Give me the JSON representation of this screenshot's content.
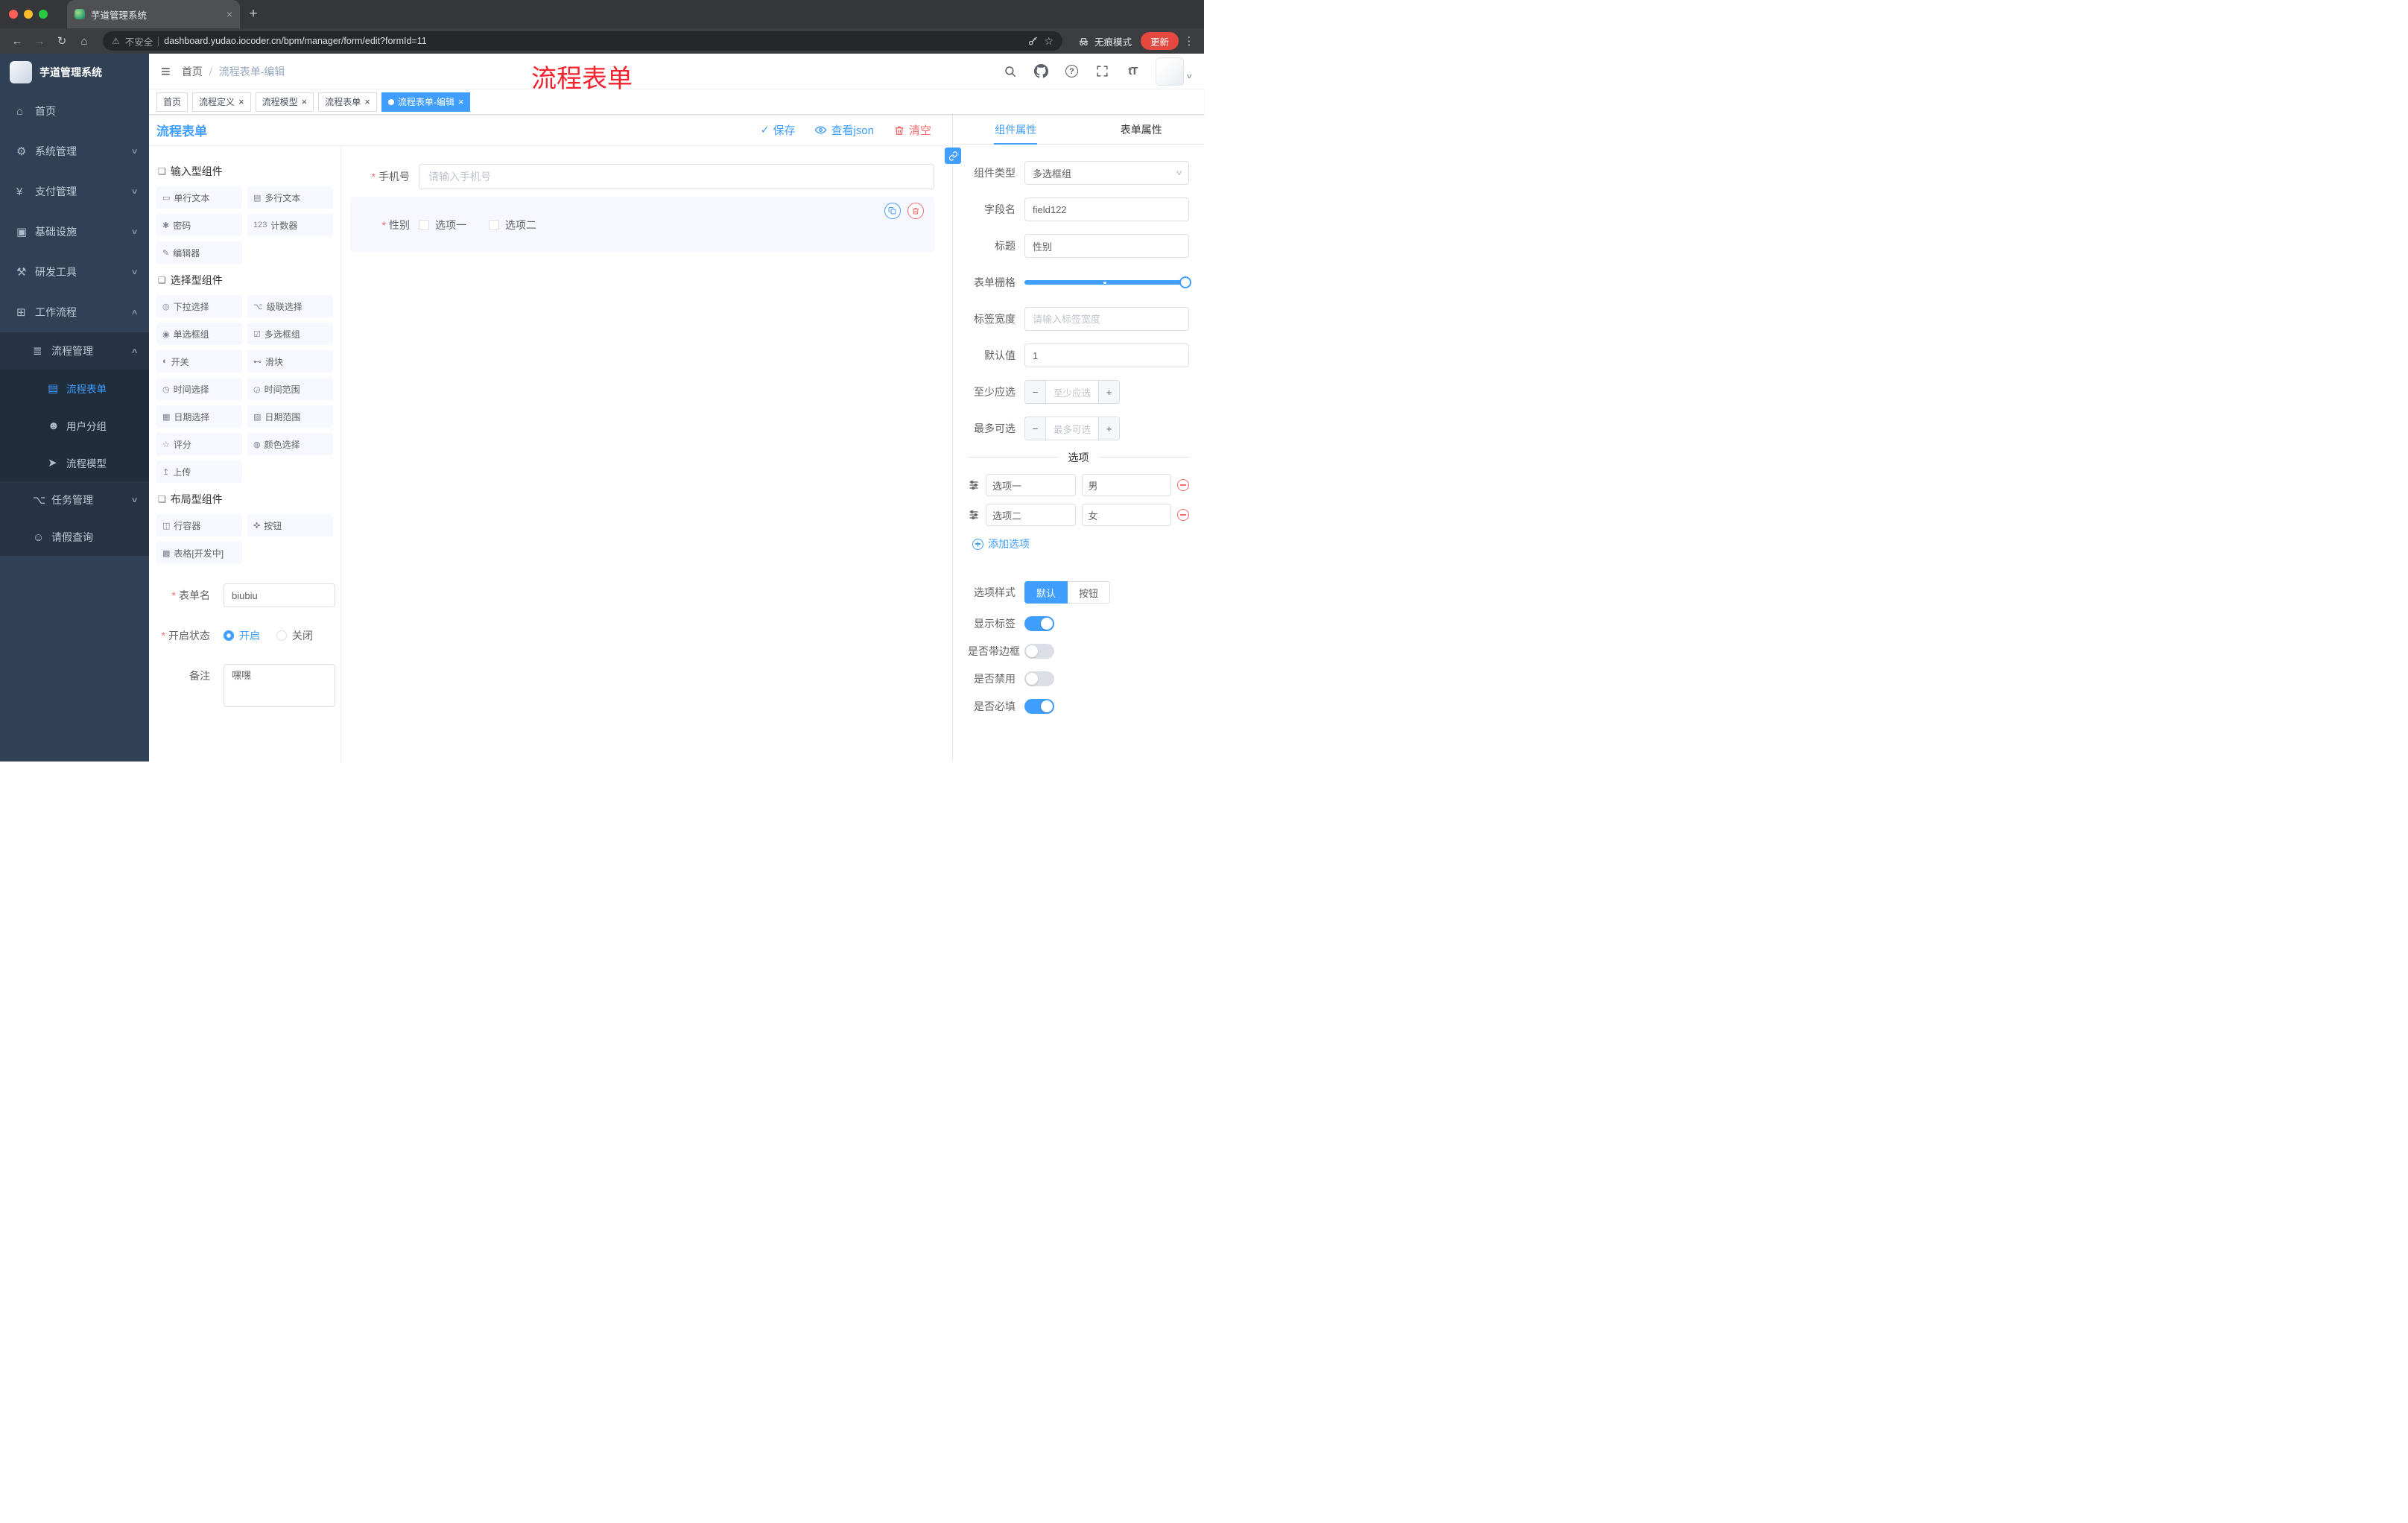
{
  "theme": {
    "primary": "#409eff",
    "danger": "#f56c6c",
    "annotation_red": "#f5222d",
    "sidebar_bg": "#304156",
    "active_tag_bg": "#409eff"
  },
  "browser": {
    "tab_title": "芋道管理系统",
    "security_label": "不安全",
    "url": "dashboard.yudao.iocoder.cn/bpm/manager/form/edit?formId=11",
    "incognito_label": "无痕模式",
    "update_label": "更新"
  },
  "sidebar": {
    "logo_title": "芋道管理系统",
    "menu": [
      {
        "label": "首页",
        "icon": "home-icon"
      },
      {
        "label": "系统管理",
        "icon": "gear-icon",
        "arrow": "collapsed"
      },
      {
        "label": "支付管理",
        "icon": "payment-icon",
        "arrow": "collapsed"
      },
      {
        "label": "基础设施",
        "icon": "infrastructure-icon",
        "arrow": "collapsed"
      },
      {
        "label": "研发工具",
        "icon": "devtools-icon",
        "arrow": "collapsed"
      },
      {
        "label": "工作流程",
        "icon": "workflow-icon",
        "arrow": "expanded"
      }
    ],
    "process_menu": {
      "label": "流程管理",
      "icon": "process-icon",
      "arrow": "expanded"
    },
    "process_children": [
      {
        "label": "流程表单",
        "icon": "form-icon",
        "active": true
      },
      {
        "label": "用户分组",
        "icon": "users-icon"
      },
      {
        "label": "流程模型",
        "icon": "model-icon"
      }
    ],
    "workflow_siblings": [
      {
        "label": "任务管理",
        "icon": "task-icon",
        "arrow": "collapsed"
      },
      {
        "label": "请假查询",
        "icon": "person-icon"
      }
    ]
  },
  "header": {
    "breadcrumb_home": "首页",
    "breadcrumb_separator": "/",
    "breadcrumb_current": "流程表单-编辑",
    "annotation": "流程表单"
  },
  "tags": [
    {
      "label": "首页"
    },
    {
      "label": "流程定义",
      "closable": true
    },
    {
      "label": "流程模型",
      "closable": true
    },
    {
      "label": "流程表单",
      "closable": true
    },
    {
      "label": "流程表单-编辑",
      "closable": true,
      "active": true
    }
  ],
  "designer": {
    "title": "流程表单",
    "save_label": "保存",
    "view_json_label": "查看json",
    "clear_label": "清空",
    "groups": [
      {
        "title": "输入型组件",
        "items": [
          {
            "label": "单行文本",
            "icon": "input-icon"
          },
          {
            "label": "多行文本",
            "icon": "textarea-icon"
          },
          {
            "label": "密码",
            "icon": "password-icon"
          },
          {
            "label": "计数器",
            "icon": "counter-icon"
          },
          {
            "label": "编辑器",
            "icon": "editor-icon"
          }
        ]
      },
      {
        "title": "选择型组件",
        "items": [
          {
            "label": "下拉选择",
            "icon": "select-icon"
          },
          {
            "label": "级联选择",
            "icon": "cascader-icon"
          },
          {
            "label": "单选框组",
            "icon": "radio-icon"
          },
          {
            "label": "多选框组",
            "icon": "checkbox-group-icon"
          },
          {
            "label": "开关",
            "icon": "switch-icon"
          },
          {
            "label": "滑块",
            "icon": "slider-icon"
          },
          {
            "label": "时间选择",
            "icon": "time-icon"
          },
          {
            "label": "时间范围",
            "icon": "time-range-icon"
          },
          {
            "label": "日期选择",
            "icon": "date-icon"
          },
          {
            "label": "日期范围",
            "icon": "date-range-icon"
          },
          {
            "label": "评分",
            "icon": "rate-icon"
          },
          {
            "label": "颜色选择",
            "icon": "color-icon"
          },
          {
            "label": "上传",
            "icon": "upload-icon"
          }
        ]
      },
      {
        "title": "布局型组件",
        "items": [
          {
            "label": "行容器",
            "icon": "row-icon"
          },
          {
            "label": "按钮",
            "icon": "button-icon"
          },
          {
            "label": "表格[开发中]",
            "icon": "table-icon"
          }
        ]
      }
    ],
    "meta": {
      "form_name_label": "表单名",
      "form_name_value": "biubiu",
      "status_label": "开启状态",
      "status_on": "开启",
      "status_off": "关闭",
      "status_selected": "开启",
      "remark_label": "备注",
      "remark_value": "嘿嘿"
    }
  },
  "canvas": {
    "phone_label": "手机号",
    "phone_placeholder": "请输入手机号",
    "gender_label": "性别",
    "gender_options": [
      "选项一",
      "选项二"
    ]
  },
  "properties": {
    "tabs": [
      {
        "label": "组件属性",
        "active": true
      },
      {
        "label": "表单属性"
      }
    ],
    "component_type_label": "组件类型",
    "component_type_value": "多选框组",
    "field_name_label": "字段名",
    "field_name_value": "field122",
    "title_label": "标题",
    "title_value": "性别",
    "grid_label": "表单栅格",
    "label_width_label": "标签宽度",
    "label_width_placeholder": "请输入标签宽度",
    "default_label": "默认值",
    "default_value": "1",
    "min_label": "至少应选",
    "min_placeholder": "至少应选",
    "max_label": "最多可选",
    "max_placeholder": "最多可选",
    "options_divider": "选项",
    "options": [
      {
        "name": "选项一",
        "value": "男"
      },
      {
        "name": "选项二",
        "value": "女"
      }
    ],
    "add_option_label": "添加选项",
    "option_style_label": "选项样式",
    "option_styles": [
      {
        "label": "默认",
        "active": true
      },
      {
        "label": "按钮"
      }
    ],
    "switches": [
      {
        "label": "显示标签",
        "on": true
      },
      {
        "label": "是否带边框",
        "on": false
      },
      {
        "label": "是否禁用",
        "on": false
      },
      {
        "label": "是否必填",
        "on": true
      }
    ]
  }
}
